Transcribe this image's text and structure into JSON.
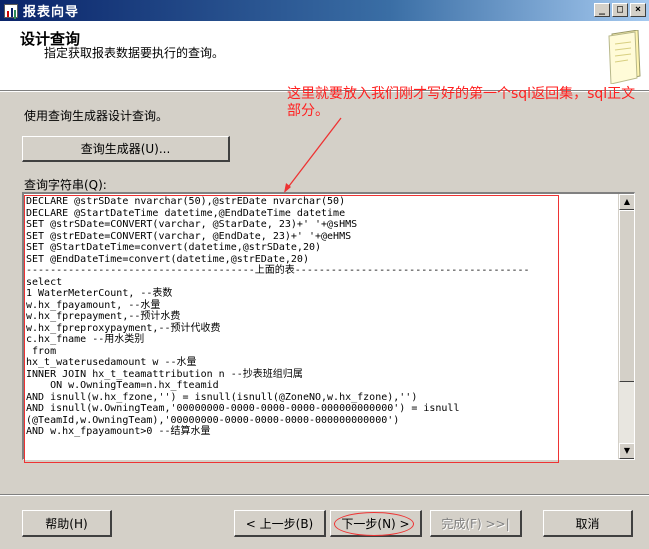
{
  "window": {
    "title": "报表向导",
    "controls": [
      "_",
      "□",
      "×"
    ]
  },
  "header": {
    "title": "设计查询",
    "subtitle": "指定获取报表数据要执行的查询。",
    "icon": "document-icon"
  },
  "main": {
    "prompt": "使用查询生成器设计查询。",
    "query_builder_label": "查询生成器(U)...",
    "query_string_label": "查询字符串(Q):",
    "query_lines": [
      "DECLARE @strSDate nvarchar(50),@strEDate nvarchar(50)",
      "DECLARE @StartDateTime datetime,@EndDateTime datetime",
      "SET @strSDate=CONVERT(varchar, @StarDate, 23)+' '+@sHMS",
      "SET @strEDate=CONVERT(varchar, @EndDate, 23)+' '+@eHMS",
      "SET @StartDateTime=convert(datetime,@strSDate,20)",
      "SET @EndDateTime=convert(datetime,@strEDate,20)",
      "--------------------------------------上面的表---------------------------------------",
      "select",
      "1 WaterMeterCount, --表数",
      "w.hx_fpayamount, --水量",
      "w.hx_fprepayment,--预计水费",
      "w.hx_fpreproxypayment,--预计代收费",
      "c.hx_fname --用水类别",
      " from",
      "hx_t_waterusedamount w --水量",
      "INNER JOIN hx_t_teamattribution n --抄表班组归属",
      "    ON w.OwningTeam=n.hx_fteamid",
      "AND isnull(w.hx_fzone,'') = isnull(isnull(@ZoneNO,w.hx_fzone),'')",
      "AND isnull(w.OwningTeam,'00000000-0000-0000-0000-000000000000') = isnull",
      "(@TeamId,w.OwningTeam),'00000000-0000-0000-0000-000000000000')",
      "AND w.hx_fpayamount>0 --结算水量"
    ]
  },
  "annotation": {
    "text": "这里就要放入我们刚才写好的第一个sql返回集，sql正文部分。",
    "color": "#ff2020"
  },
  "footer": {
    "help": "帮助(H)",
    "back": "< 上一步(B)",
    "next": "下一步(N) >",
    "finish": "完成(F) >>|",
    "cancel": "取消"
  }
}
